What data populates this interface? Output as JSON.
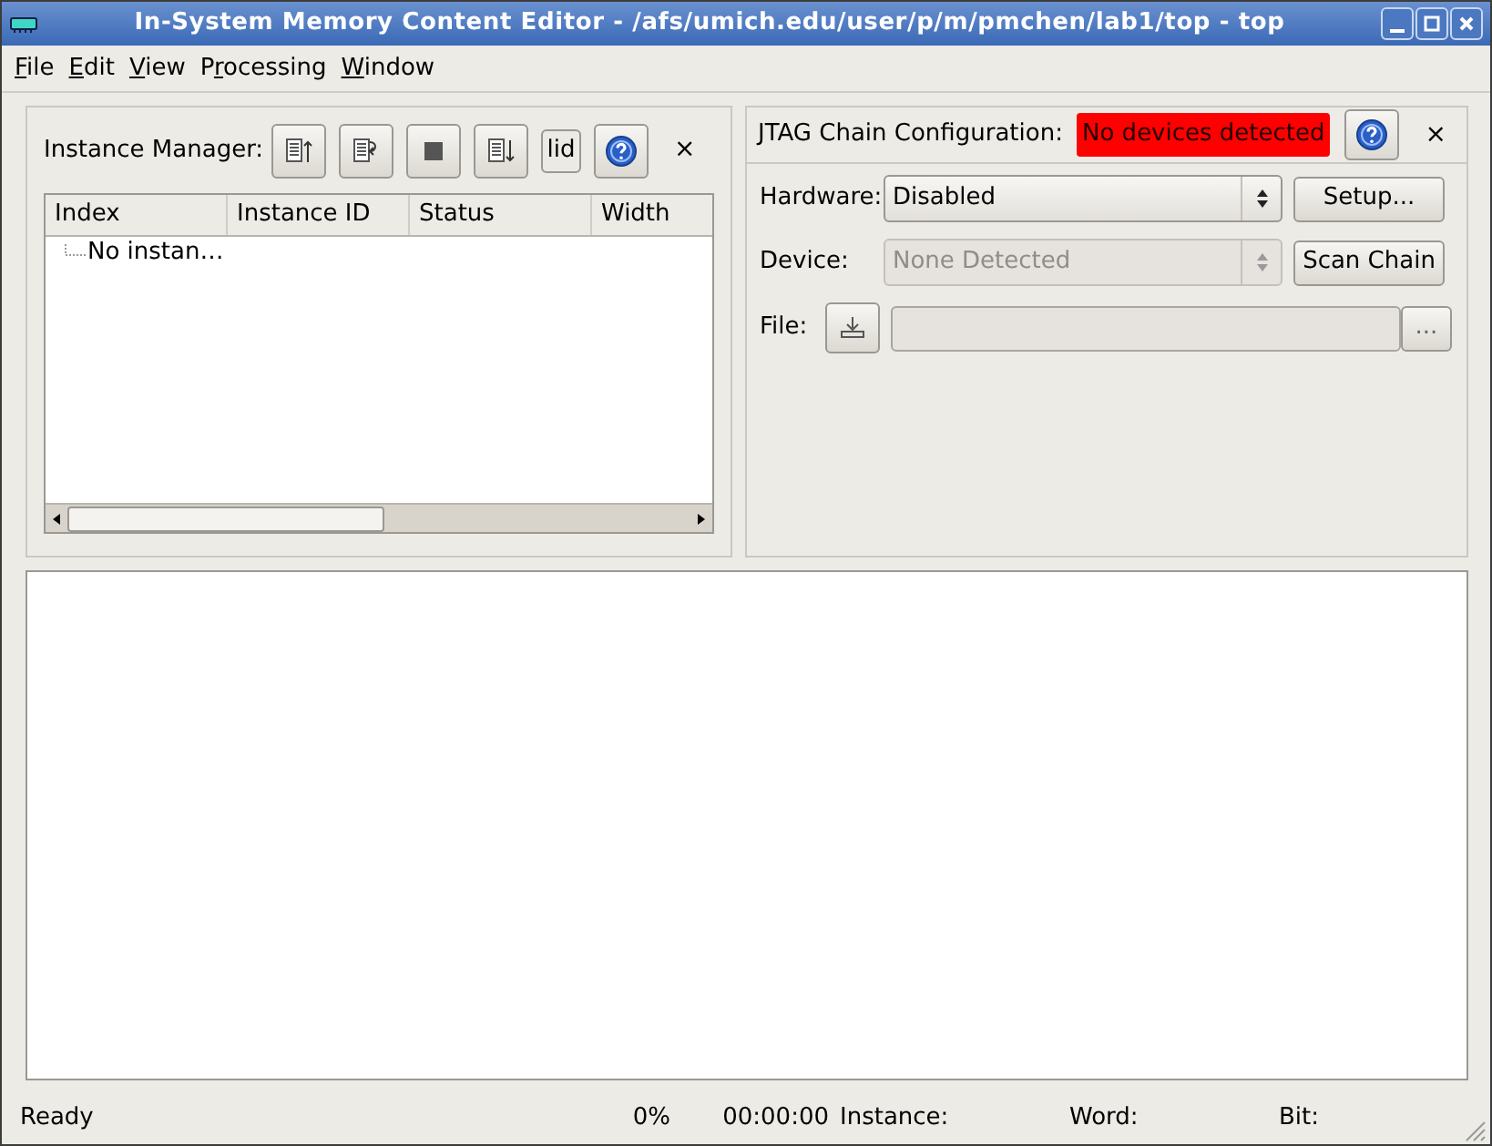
{
  "window": {
    "title": "In-System Memory Content Editor - /afs/umich.edu/user/p/m/pmchen/lab1/top - top"
  },
  "menu": [
    {
      "key": "F",
      "after": "ile"
    },
    {
      "key": "E",
      "after": "dit"
    },
    {
      "key": "V",
      "after": "iew"
    },
    {
      "before": "P",
      "key": "r",
      "after": "ocessing"
    },
    {
      "key": "W",
      "after": "indow"
    }
  ],
  "instance_manager": {
    "label": "Instance Manager:",
    "lid_button": "lid",
    "close": "×",
    "columns": [
      "Index",
      "Instance ID",
      "Status",
      "Width"
    ],
    "rows": [
      {
        "text": "No instan…"
      }
    ]
  },
  "jtag": {
    "label": "JTAG Chain Configuration:",
    "status": "No devices detected",
    "close": "×",
    "hardware": {
      "label": "Hardware:",
      "value": "Disabled",
      "disabled": false,
      "button": "Setup..."
    },
    "device": {
      "label": "Device:",
      "value": "None Detected",
      "disabled": true,
      "button": "Scan Chain"
    },
    "file": {
      "label": "File:",
      "button": "..."
    }
  },
  "status_bar": {
    "message": "Ready",
    "progress": "0%",
    "time": "00:00:00",
    "instance": "Instance:",
    "word": "Word:",
    "bit": "Bit:"
  }
}
